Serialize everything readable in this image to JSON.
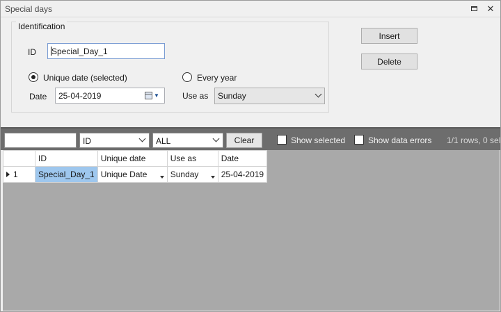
{
  "window": {
    "title": "Special days"
  },
  "identification": {
    "legend": "Identification",
    "id_label": "ID",
    "id_value": "Special_Day_1",
    "unique_date_label": "Unique date (selected)",
    "unique_date_checked": true,
    "every_year_label": "Every year",
    "every_year_checked": false,
    "date_label": "Date",
    "date_value": "25-04-2019",
    "use_as_label": "Use as",
    "use_as_value": "Sunday"
  },
  "actions": {
    "insert_label": "Insert",
    "delete_label": "Delete"
  },
  "filter": {
    "search_value": "",
    "column_value": "ID",
    "scope_value": "ALL",
    "clear_label": "Clear",
    "show_selected_label": "Show selected",
    "show_data_errors_label": "Show data errors",
    "row_count": "1/1 rows, 0 sel"
  },
  "grid": {
    "headers": [
      "ID",
      "Unique date",
      "Use as",
      "Date"
    ],
    "rows": [
      {
        "num": "1",
        "id": "Special_Day_1",
        "unique_date": "Unique Date",
        "use_as": "Sunday",
        "date": "25-04-2019"
      }
    ]
  },
  "icons": {
    "restore": "restore-icon",
    "close": "close-icon",
    "calendar": "calendar-icon",
    "row_pointer": "row-pointer-icon"
  },
  "colors": {
    "selected_cell": "#9ec7ee",
    "filter_bar": "#6d6d6d",
    "grid_background": "#a9a9a9",
    "focus_border": "#7a9cd3"
  }
}
